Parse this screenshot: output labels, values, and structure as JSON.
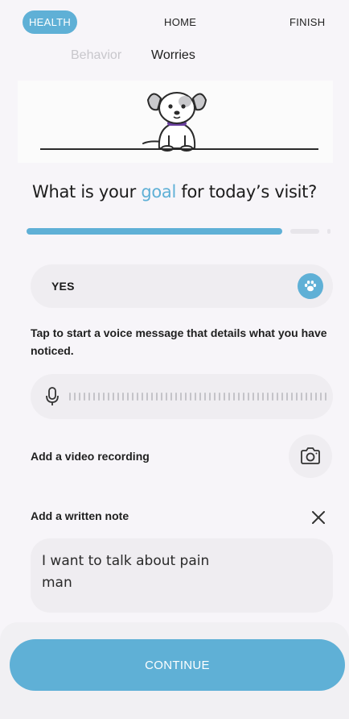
{
  "top_nav": {
    "tabs": [
      {
        "label": "HEALTH",
        "active": true
      },
      {
        "label": "HOME",
        "active": false
      },
      {
        "label": "FINISH",
        "active": false
      }
    ]
  },
  "sub_tabs": [
    {
      "label": "Behavior",
      "active": false
    },
    {
      "label": "Worries",
      "active": true
    }
  ],
  "illustration": {
    "icon": "dog-icon"
  },
  "question": {
    "prefix": "What is your ",
    "highlight": "goal",
    "suffix": " for today’s visit?"
  },
  "progress": {
    "fraction": 0.75,
    "segments_total": 3,
    "segments_done": 1
  },
  "answer": {
    "value": "YES",
    "icon": "paw-icon"
  },
  "voice": {
    "instructions": "Tap to start a voice message that details what you have noticed.",
    "icon": "microphone-icon"
  },
  "video": {
    "label": "Add a video recording",
    "icon": "camera-icon"
  },
  "note": {
    "label": "Add a written note",
    "close_icon": "close-icon",
    "value": "I want to talk about pain\nman"
  },
  "continue_button": {
    "label": "CONTINUE"
  },
  "colors": {
    "accent": "#5fb0d6",
    "background": "#f7f5f9",
    "field": "#efedf1",
    "collar": "#6a3fa0"
  }
}
